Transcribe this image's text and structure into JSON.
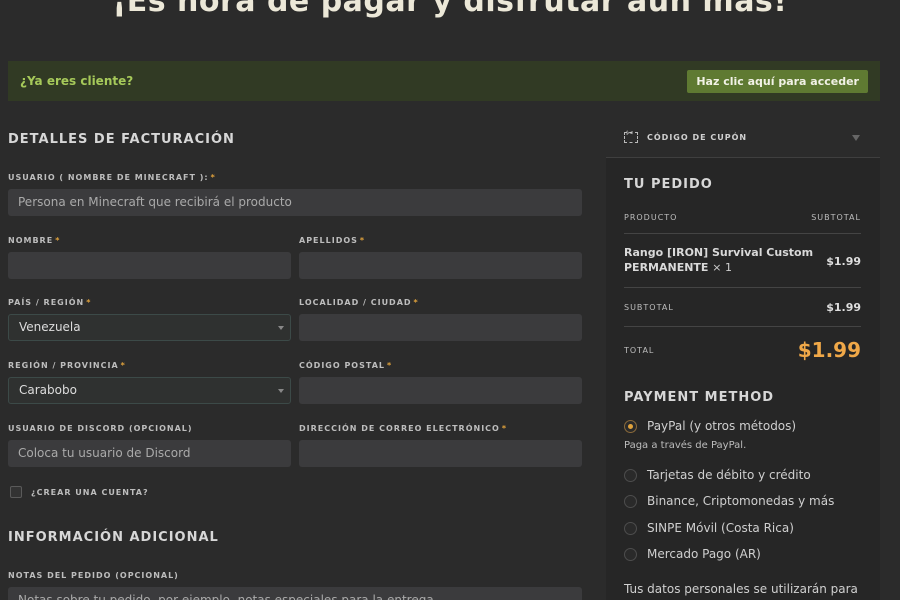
{
  "hero": {
    "title": "¡Es hora de pagar y disfrutar aún más!"
  },
  "login": {
    "prompt": "¿Ya eres cliente?",
    "button": "Haz clic aquí para acceder"
  },
  "billing": {
    "title": "DETALLES DE FACTURACIÓN",
    "required_mark": "*",
    "username_label": "USUARIO ( NOMBRE DE MINECRAFT ):",
    "username_placeholder": "Persona en Minecraft que recibirá el producto",
    "first_name_label": "NOMBRE",
    "last_name_label": "APELLIDOS",
    "country_label": "PAÍS / REGIÓN",
    "country_value": "Venezuela",
    "city_label": "LOCALIDAD / CIUDAD",
    "state_label": "REGIÓN / PROVINCIA",
    "state_value": "Carabobo",
    "postcode_label": "CÓDIGO POSTAL",
    "discord_label": "USUARIO DE DISCORD (OPCIONAL)",
    "discord_placeholder": "Coloca tu usuario de Discord",
    "email_label": "DIRECCIÓN DE CORREO ELECTRÓNICO",
    "create_account_label": "¿CREAR UNA CUENTA?"
  },
  "additional": {
    "title": "INFORMACIÓN ADICIONAL",
    "notes_label": "NOTAS DEL PEDIDO (OPCIONAL)",
    "notes_placeholder": "Notas sobre tu pedido, por ejemplo, notas especiales para la entrega."
  },
  "coupon": {
    "label": "CÓDIGO DE CUPÓN"
  },
  "order": {
    "title": "TU PEDIDO",
    "product_col": "PRODUCTO",
    "subtotal_col": "SUBTOTAL",
    "product_name": "Rango [IRON] Survival Custom PERMANENTE",
    "product_qty": "× 1",
    "product_price": "$1.99",
    "subtotal_label": "SUBTOTAL",
    "subtotal_value": "$1.99",
    "total_label": "TOTAL",
    "total_value": "$1.99"
  },
  "payment": {
    "title": "PAYMENT METHOD",
    "methods": [
      "PayPal (y otros métodos)",
      "Tarjetas de débito y crédito",
      "Binance, Criptomonedas y más",
      "SINPE Móvil (Costa Rica)",
      "Mercado Pago (AR)"
    ],
    "selected_desc": "Paga a través de PayPal.",
    "privacy_text": "Tus datos personales se utilizarán para"
  },
  "colors": {
    "accent": "#e0a23c",
    "login_bar": "#313a24",
    "login_button": "#5f7a32"
  }
}
